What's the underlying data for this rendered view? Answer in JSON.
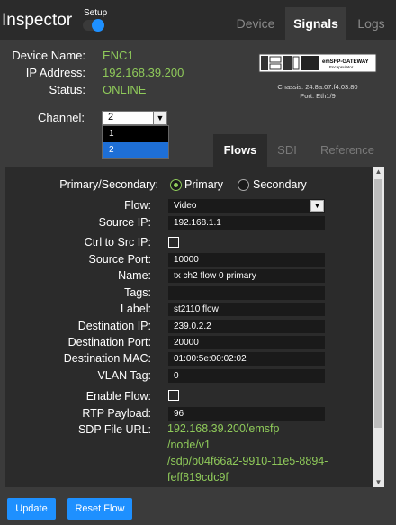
{
  "header": {
    "title": "Inspector",
    "setup_label": "Setup",
    "setup_enabled": true,
    "tabs": [
      {
        "label": "Device",
        "active": false
      },
      {
        "label": "Signals",
        "active": true
      },
      {
        "label": "Logs",
        "active": false
      }
    ]
  },
  "device": {
    "name_key": "Device Name:",
    "name": "ENC1",
    "ip_key": "IP Address:",
    "ip": "192.168.39.200",
    "status_key": "Status:",
    "status": "ONLINE",
    "image_label": "emSFP-GATEWAY",
    "image_sublabel": "Encapsulator",
    "chassis": "Chassis: 24:8a:07:f4:03:80",
    "port": "Port: Eth1/9"
  },
  "channel": {
    "label": "Channel:",
    "value": "2",
    "options": [
      "1",
      "2"
    ],
    "selected_index": 1
  },
  "subtabs": [
    {
      "label": "Flows",
      "active": true
    },
    {
      "label": "SDI",
      "active": false
    },
    {
      "label": "Reference",
      "active": false
    }
  ],
  "flow_form": {
    "primary_secondary_label": "Primary/Secondary:",
    "primary_label": "Primary",
    "secondary_label": "Secondary",
    "primary_selected": true,
    "flow_label": "Flow:",
    "flow": "Video",
    "source_ip_label": "Source IP:",
    "source_ip": "192.168.1.1",
    "ctrl_label": "Ctrl to Src IP:",
    "ctrl_checked": false,
    "source_port_label": "Source Port:",
    "source_port": "10000",
    "name_label": "Name:",
    "name": "tx ch2 flow 0 primary",
    "tags_label": "Tags:",
    "tags": "",
    "label_label": "Label:",
    "label": "st2110 flow",
    "dest_ip_label": "Destination IP:",
    "dest_ip": "239.0.2.2",
    "dest_port_label": "Destination Port:",
    "dest_port": "20000",
    "dest_mac_label": "Destination MAC:",
    "dest_mac": "01:00:5e:00:02:02",
    "vlan_label": "VLAN Tag:",
    "vlan": "0",
    "enable_label": "Enable Flow:",
    "enable_checked": false,
    "rtp_label": "RTP Payload:",
    "rtp": "96",
    "sdp_label": "SDP File URL:",
    "sdp_lines": [
      "192.168.39.200/emsfp",
      "/node/v1",
      "/sdp/b04f66a2-9910-11e5-8894-",
      "feff819cdc9f"
    ]
  },
  "buttons": {
    "update": "Update",
    "reset": "Reset Flow"
  },
  "colors": {
    "accent": "#1e90ff",
    "value_green": "#8fca5a",
    "panel": "#3b3b3b",
    "background": "#2b2b2b"
  }
}
